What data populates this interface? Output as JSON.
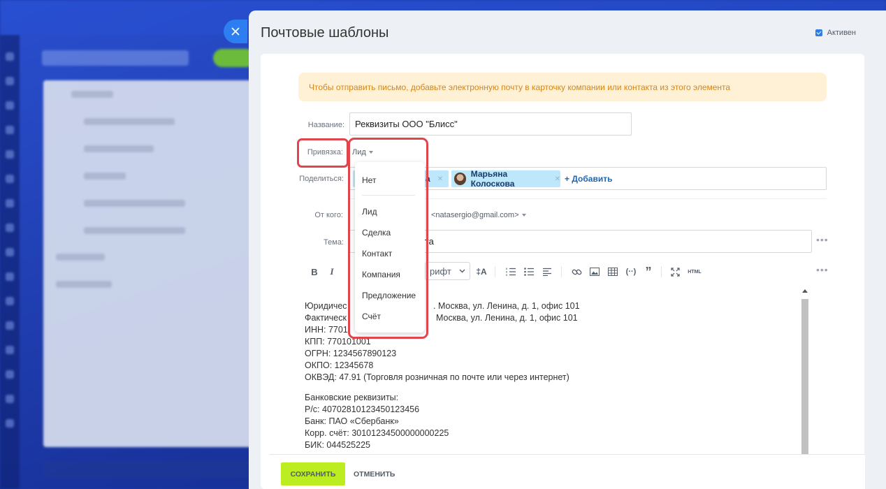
{
  "slider": {
    "title": "Почтовые шаблоны",
    "active_label": "Активен",
    "active_checked": true,
    "close_icon": "close-icon"
  },
  "alert": {
    "text": "Чтобы отправить письмо, добавьте электронную почту в карточку компании или контакта из этого элемента"
  },
  "form": {
    "name_label": "Название:",
    "name_value": "Реквизиты ООО \"Блисс\"",
    "binding_label": "Привязка:",
    "binding_value": "Лид",
    "share_label": "Поделиться:",
    "share_tags": [
      {
        "name": "а"
      },
      {
        "name": "Марьяна Колоскова"
      }
    ],
    "add_label": "+ Добавить",
    "from_label": "От кого:",
    "from_value": "<natasergio@gmail.com>",
    "subject_label": "Тема:",
    "subject_value": "ета"
  },
  "dropdown": {
    "items": [
      "Нет",
      "Лид",
      "Сделка",
      "Контакт",
      "Компания",
      "Предложение",
      "Счёт"
    ]
  },
  "toolbar": {
    "bold": "B",
    "italic": "I",
    "font_label": "рифт",
    "font_size": "‡A",
    "quote": "”",
    "html": "HTML"
  },
  "editor": {
    "lines": [
      "Юридичес",
      ". Москва, ул. Ленина, д. 1, офис 101",
      "Фактическ",
      "Москва, ул. Ленина, д. 1, офис 101",
      "ИНН: 7701",
      "КПП: 770101001",
      "ОГРН: 1234567890123",
      "ОКПО: 12345678",
      "ОКВЭД: 47.91 (Торговля розничная по почте или через интернет)",
      "Банковские реквизиты:",
      "Р/с: 40702810123450123456",
      "Банк: ПАО «Сбербанк»",
      "Корр. счёт: 30101234500000000225",
      "БИК: 044525225"
    ]
  },
  "footer": {
    "save_label": "СОХРАНИТЬ",
    "cancel_label": "ОТМЕНИТЬ"
  },
  "colors": {
    "accent": "#2f7de1",
    "save": "#bbed21",
    "highlight": "#e0454d",
    "alert_bg": "#fff1d6",
    "alert_text": "#d4861a",
    "tag_bg": "#bde8fb"
  }
}
